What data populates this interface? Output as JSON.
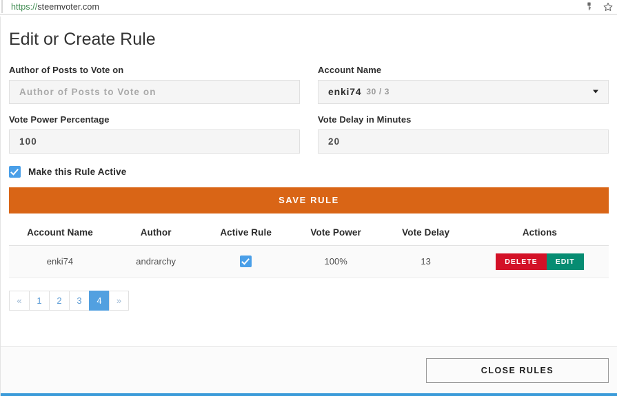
{
  "browser": {
    "url_scheme": "https://",
    "url_host": "steemvoter.com",
    "icons": [
      {
        "name": "key-icon",
        "glyph": "⚷"
      },
      {
        "name": "bookmark-star-icon",
        "glyph": "☆"
      }
    ]
  },
  "page": {
    "title": "Edit or Create Rule"
  },
  "form": {
    "author_label": "Author of Posts to Vote on",
    "author_placeholder": "Author of Posts to Vote on",
    "author_value": "",
    "account_label": "Account Name",
    "account_value": "enki74",
    "account_counts": "30 / 3",
    "vote_power_label": "Vote Power Percentage",
    "vote_power_value": "100",
    "vote_delay_label": "Vote Delay in Minutes",
    "vote_delay_value": "20",
    "active_checkbox_label": "Make this Rule Active",
    "active_checkbox_checked": true,
    "save_label": "SAVE RULE"
  },
  "table": {
    "headers": [
      "Account Name",
      "Author",
      "Active Rule",
      "Vote Power",
      "Vote Delay",
      "Actions"
    ],
    "rows": [
      {
        "account_name": "enki74",
        "author": "andrarchy",
        "active_rule": true,
        "vote_power": "100%",
        "vote_delay": "13",
        "delete_label": "DELETE",
        "edit_label": "EDIT"
      }
    ]
  },
  "pagination": {
    "prev": "«",
    "next": "»",
    "pages": [
      "1",
      "2",
      "3",
      "4"
    ],
    "active_page": "4"
  },
  "footer": {
    "close_label": "CLOSE RULES"
  },
  "colors": {
    "accent_orange": "#d96516",
    "checkbox_blue": "#4a9fe8",
    "delete_red": "#d31127",
    "edit_green": "#068c72",
    "page_active_blue": "#52a0e0",
    "bottom_strip_blue": "#3b9bd9"
  }
}
